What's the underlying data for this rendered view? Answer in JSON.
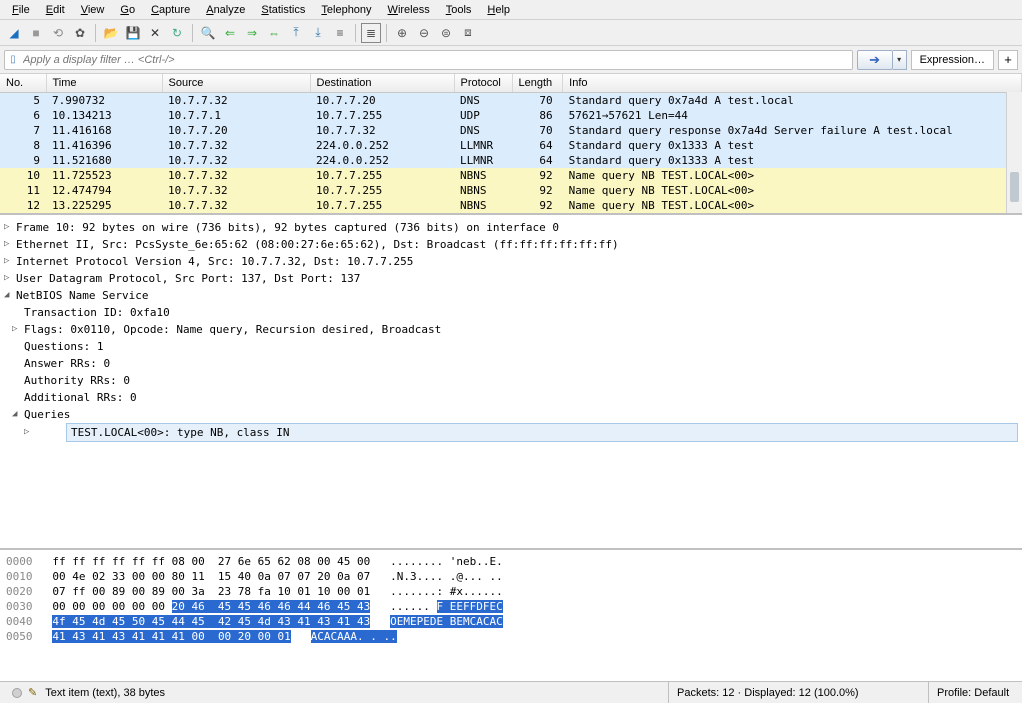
{
  "menu": [
    "File",
    "Edit",
    "View",
    "Go",
    "Capture",
    "Analyze",
    "Statistics",
    "Telephony",
    "Wireless",
    "Tools",
    "Help"
  ],
  "filter": {
    "placeholder": "Apply a display filter … <Ctrl-/>",
    "expression_label": "Expression…"
  },
  "columns": [
    "No.",
    "Time",
    "Source",
    "Destination",
    "Protocol",
    "Length",
    "Info"
  ],
  "packets": [
    {
      "no": "5",
      "time": "7.990732",
      "src": "10.7.7.32",
      "dst": "10.7.7.20",
      "proto": "DNS",
      "len": "70",
      "info": "Standard query 0x7a4d A test.local",
      "cls": "row-blue"
    },
    {
      "no": "6",
      "time": "10.134213",
      "src": "10.7.7.1",
      "dst": "10.7.7.255",
      "proto": "UDP",
      "len": "86",
      "info": "57621→57621 Len=44",
      "cls": "row-blue"
    },
    {
      "no": "7",
      "time": "11.416168",
      "src": "10.7.7.20",
      "dst": "10.7.7.32",
      "proto": "DNS",
      "len": "70",
      "info": "Standard query response 0x7a4d Server failure A test.local",
      "cls": "row-blue"
    },
    {
      "no": "8",
      "time": "11.416396",
      "src": "10.7.7.32",
      "dst": "224.0.0.252",
      "proto": "LLMNR",
      "len": "64",
      "info": "Standard query 0x1333 A test",
      "cls": "row-blue"
    },
    {
      "no": "9",
      "time": "11.521680",
      "src": "10.7.7.32",
      "dst": "224.0.0.252",
      "proto": "LLMNR",
      "len": "64",
      "info": "Standard query 0x1333 A test",
      "cls": "row-blue"
    },
    {
      "no": "10",
      "time": "11.725523",
      "src": "10.7.7.32",
      "dst": "10.7.7.255",
      "proto": "NBNS",
      "len": "92",
      "info": "Name query NB TEST.LOCAL<00>",
      "cls": "row-yellow"
    },
    {
      "no": "11",
      "time": "12.474794",
      "src": "10.7.7.32",
      "dst": "10.7.7.255",
      "proto": "NBNS",
      "len": "92",
      "info": "Name query NB TEST.LOCAL<00>",
      "cls": "row-yellow"
    },
    {
      "no": "12",
      "time": "13.225295",
      "src": "10.7.7.32",
      "dst": "10.7.7.255",
      "proto": "NBNS",
      "len": "92",
      "info": "Name query NB TEST.LOCAL<00>",
      "cls": "row-yellow"
    }
  ],
  "details": {
    "frame": "Frame 10: 92 bytes on wire (736 bits), 92 bytes captured (736 bits) on interface 0",
    "eth": "Ethernet II, Src: PcsSyste_6e:65:62 (08:00:27:6e:65:62), Dst: Broadcast (ff:ff:ff:ff:ff:ff)",
    "ip": "Internet Protocol Version 4, Src: 10.7.7.32, Dst: 10.7.7.255",
    "udp": "User Datagram Protocol, Src Port: 137, Dst Port: 137",
    "nbns": "NetBIOS Name Service",
    "txid": "Transaction ID: 0xfa10",
    "flags": "Flags: 0x0110, Opcode: Name query, Recursion desired, Broadcast",
    "questions": "Questions: 1",
    "answer": "Answer RRs: 0",
    "authority": "Authority RRs: 0",
    "additional": "Additional RRs: 0",
    "queries": "Queries",
    "query_item": "TEST.LOCAL<00>: type NB, class IN"
  },
  "hex": {
    "r0": {
      "off": "0000",
      "b": "ff ff ff ff ff ff 08 00  27 6e 65 62 08 00 45 00",
      "a": "........ 'neb..E."
    },
    "r1": {
      "off": "0010",
      "b": "00 4e 02 33 00 00 80 11  15 40 0a 07 07 20 0a 07",
      "a": ".N.3.... .@... .."
    },
    "r2": {
      "off": "0020",
      "b": "07 ff 00 89 00 89 00 3a  23 78 fa 10 01 10 00 01",
      "a": ".......: #x......"
    },
    "r3": {
      "off": "0030",
      "b1": "00 00 00 00 00 00 ",
      "b2": "20 46  45 45 46 46 44 46 45 43",
      "a1": "...... ",
      "a2": "F EEFFDFEC"
    },
    "r4": {
      "off": "0040",
      "b": "4f 45 4d 45 50 45 44 45  42 45 4d 43 41 43 41 43",
      "a": "OEMEPEDE BEMCACAC"
    },
    "r5": {
      "off": "0050",
      "b": "41 43 41 43 41 41 41 00  00 20 00 01",
      "a": "ACACAAA. . .."
    }
  },
  "status": {
    "left": "Text item (text), 38 bytes",
    "mid": "Packets: 12 · Displayed: 12 (100.0%)",
    "right": "Profile: Default"
  }
}
